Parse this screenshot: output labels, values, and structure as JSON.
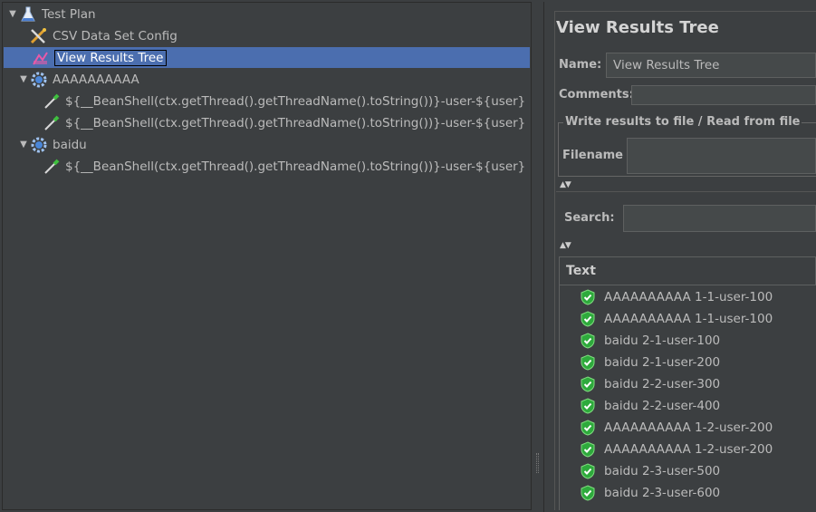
{
  "tree": {
    "items": [
      {
        "label": "Test Plan",
        "icon": "test-plan-flask-icon",
        "toggle": "▼"
      },
      {
        "label": "CSV Data Set Config",
        "icon": "csv-config-tools-icon"
      },
      {
        "label": "View Results Tree",
        "icon": "view-results-tree-icon",
        "selected": true
      },
      {
        "label": "AAAAAAAAAA",
        "icon": "thread-group-gear-icon",
        "toggle": "▼"
      },
      {
        "label": "${__BeanShell(ctx.getThread().getThreadName().toString())}-user-${user}",
        "icon": "sampler-pipette-icon"
      },
      {
        "label": "${__BeanShell(ctx.getThread().getThreadName().toString())}-user-${user}",
        "icon": "sampler-pipette-icon"
      },
      {
        "label": "baidu",
        "icon": "thread-group-gear-icon",
        "toggle": "▼"
      },
      {
        "label": "${__BeanShell(ctx.getThread().getThreadName().toString())}-user-${user}",
        "icon": "sampler-pipette-icon"
      }
    ]
  },
  "panel": {
    "title": "View Results Tree",
    "name_label": "Name:",
    "name_value": "View Results Tree",
    "comments_label": "Comments:",
    "file_group_title": "Write results to file / Read from file",
    "filename_label": "Filename",
    "search_label": "Search:",
    "renderer_selected": "Text"
  },
  "results": [
    "AAAAAAAAAA 1-1-user-100",
    "AAAAAAAAAA 1-1-user-100",
    "baidu 2-1-user-100",
    "baidu 2-1-user-200",
    "baidu 2-2-user-300",
    "baidu 2-2-user-400",
    "AAAAAAAAAA 1-2-user-200",
    "AAAAAAAAAA 1-2-user-200",
    "baidu 2-3-user-500",
    "baidu 2-3-user-600"
  ],
  "colors": {
    "background": "#3c3f41",
    "selection": "#4b6eaf",
    "success": "#2eaa3c"
  }
}
